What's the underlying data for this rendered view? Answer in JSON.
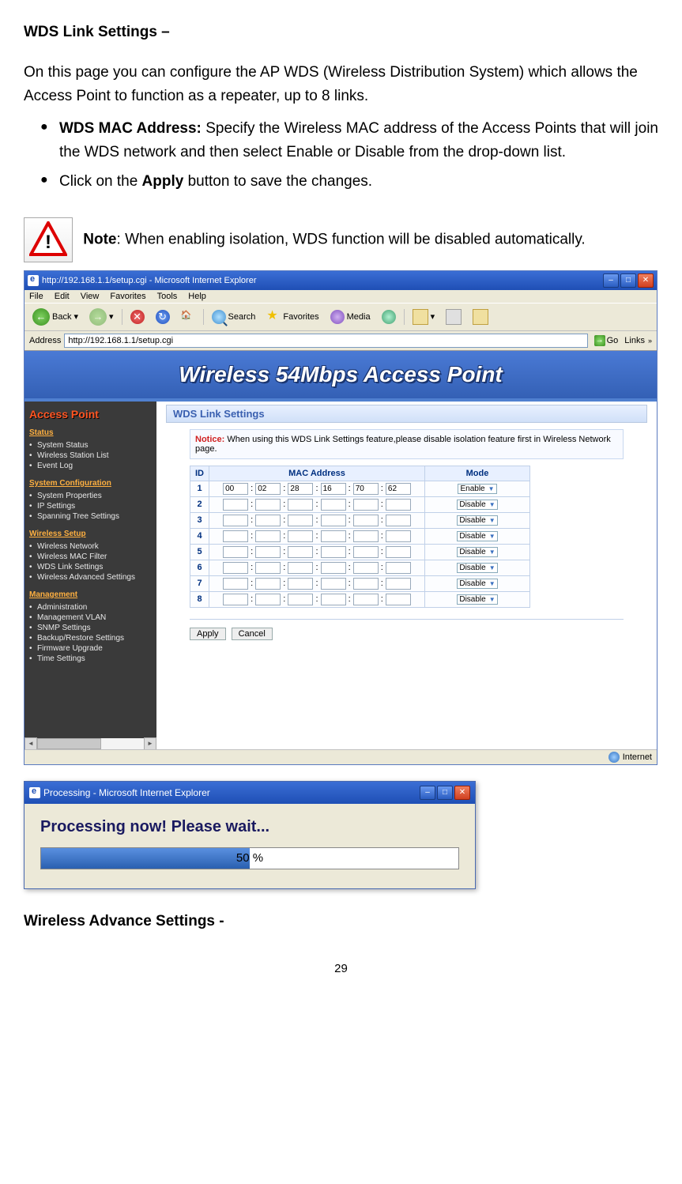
{
  "heading1": "WDS Link Settings –",
  "intro": "On this page you can configure the AP WDS (Wireless Distribution System) which allows the Access Point to function as a repeater, up to 8 links.",
  "bullets": [
    {
      "bold": "WDS MAC Address:",
      "rest": " Specify the Wireless MAC address of the Access Points that will join the WDS network and then select Enable or Disable from the drop-down list."
    },
    {
      "pre": "Click on the ",
      "bold": "Apply",
      "rest": " button to save the changes."
    }
  ],
  "note_label": "Note",
  "note_text": ": When enabling isolation, WDS function will be disabled automatically.",
  "browser": {
    "title": "http://192.168.1.1/setup.cgi - Microsoft Internet Explorer",
    "menu": [
      "File",
      "Edit",
      "View",
      "Favorites",
      "Tools",
      "Help"
    ],
    "toolbar": {
      "back": "Back",
      "search": "Search",
      "favorites": "Favorites",
      "media": "Media"
    },
    "address_label": "Address",
    "address": "http://192.168.1.1/setup.cgi",
    "go": "Go",
    "links": "Links",
    "banner": "Wireless 54Mbps Access Point",
    "sidebar": {
      "title": "Access Point",
      "groups": [
        {
          "head": "Status",
          "items": [
            "System Status",
            "Wireless Station List",
            "Event Log"
          ]
        },
        {
          "head": "System Configuration",
          "items": [
            "System Properties",
            "IP Settings",
            "Spanning Tree Settings"
          ]
        },
        {
          "head": "Wireless Setup",
          "items": [
            "Wireless Network",
            "Wireless MAC Filter",
            "WDS Link Settings",
            "Wireless Advanced Settings"
          ]
        },
        {
          "head": "Management",
          "items": [
            "Administration",
            "Management VLAN",
            "SNMP Settings",
            "Backup/Restore Settings",
            "Firmware Upgrade",
            "Time Settings"
          ]
        }
      ]
    },
    "content": {
      "title": "WDS Link Settings",
      "notice_label": "Notice:",
      "notice": " When using this WDS Link Settings feature,please disable isolation feature first in Wireless Network page.",
      "cols": [
        "ID",
        "MAC Address",
        "Mode"
      ],
      "rows": [
        {
          "id": "1",
          "mac": [
            "00",
            "02",
            "28",
            "16",
            "70",
            "62"
          ],
          "mode": "Enable"
        },
        {
          "id": "2",
          "mac": [
            "",
            "",
            "",
            "",
            "",
            ""
          ],
          "mode": "Disable"
        },
        {
          "id": "3",
          "mac": [
            "",
            "",
            "",
            "",
            "",
            ""
          ],
          "mode": "Disable"
        },
        {
          "id": "4",
          "mac": [
            "",
            "",
            "",
            "",
            "",
            ""
          ],
          "mode": "Disable"
        },
        {
          "id": "5",
          "mac": [
            "",
            "",
            "",
            "",
            "",
            ""
          ],
          "mode": "Disable"
        },
        {
          "id": "6",
          "mac": [
            "",
            "",
            "",
            "",
            "",
            ""
          ],
          "mode": "Disable"
        },
        {
          "id": "7",
          "mac": [
            "",
            "",
            "",
            "",
            "",
            ""
          ],
          "mode": "Disable"
        },
        {
          "id": "8",
          "mac": [
            "",
            "",
            "",
            "",
            "",
            ""
          ],
          "mode": "Disable"
        }
      ],
      "apply": "Apply",
      "cancel": "Cancel"
    },
    "status": "Internet"
  },
  "dialog": {
    "title": "Processing - Microsoft Internet Explorer",
    "msg": "Processing now! Please wait...",
    "percent": 50,
    "percent_label": "50 %"
  },
  "heading2": "Wireless Advance Settings -",
  "page_num": "29"
}
